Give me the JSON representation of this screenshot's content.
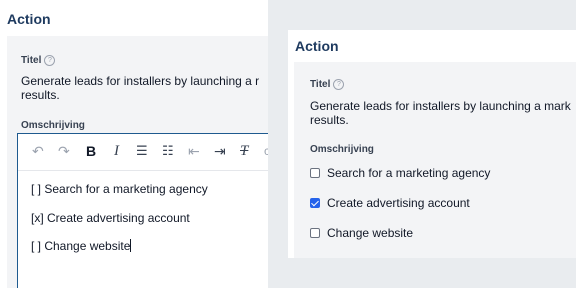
{
  "left": {
    "title": "Action",
    "titel_label": "Titel",
    "help_glyph": "?",
    "titel_line1": "Generate leads for installers by launching a r",
    "titel_line2": "results.",
    "omschrijving_label": "Omschrijving",
    "toolbar": {
      "undo": "↶",
      "redo": "↷",
      "bold": "B",
      "italic": "I",
      "bullet_list": "☰",
      "numbered_list": "☷",
      "outdent": "⇤",
      "indent": "⇥",
      "clear_format": "T",
      "more": "c"
    },
    "editor_lines": [
      "[ ] Search for a marketing agency",
      "[x] Create advertising account",
      "[ ] Change website"
    ]
  },
  "right": {
    "title": "Action",
    "titel_label": "Titel",
    "help_glyph": "?",
    "titel_line1": "Generate leads for installers by launching a mark",
    "titel_line2": "results.",
    "omschrijving_label": "Omschrijving",
    "checklist": [
      {
        "label": "Search for a marketing agency",
        "checked": false
      },
      {
        "label": "Create advertising account",
        "checked": true
      },
      {
        "label": "Change website",
        "checked": false
      }
    ]
  },
  "colors": {
    "accent": "#1e5a8f",
    "title": "#1e3a5f",
    "checkbox_checked": "#2563eb",
    "gray_bg": "#e9ecef"
  },
  "icons": [
    "help-icon",
    "undo-icon",
    "redo-icon",
    "bold-icon",
    "italic-icon",
    "bullet-list-icon",
    "numbered-list-icon",
    "outdent-icon",
    "indent-icon",
    "clear-format-icon"
  ]
}
